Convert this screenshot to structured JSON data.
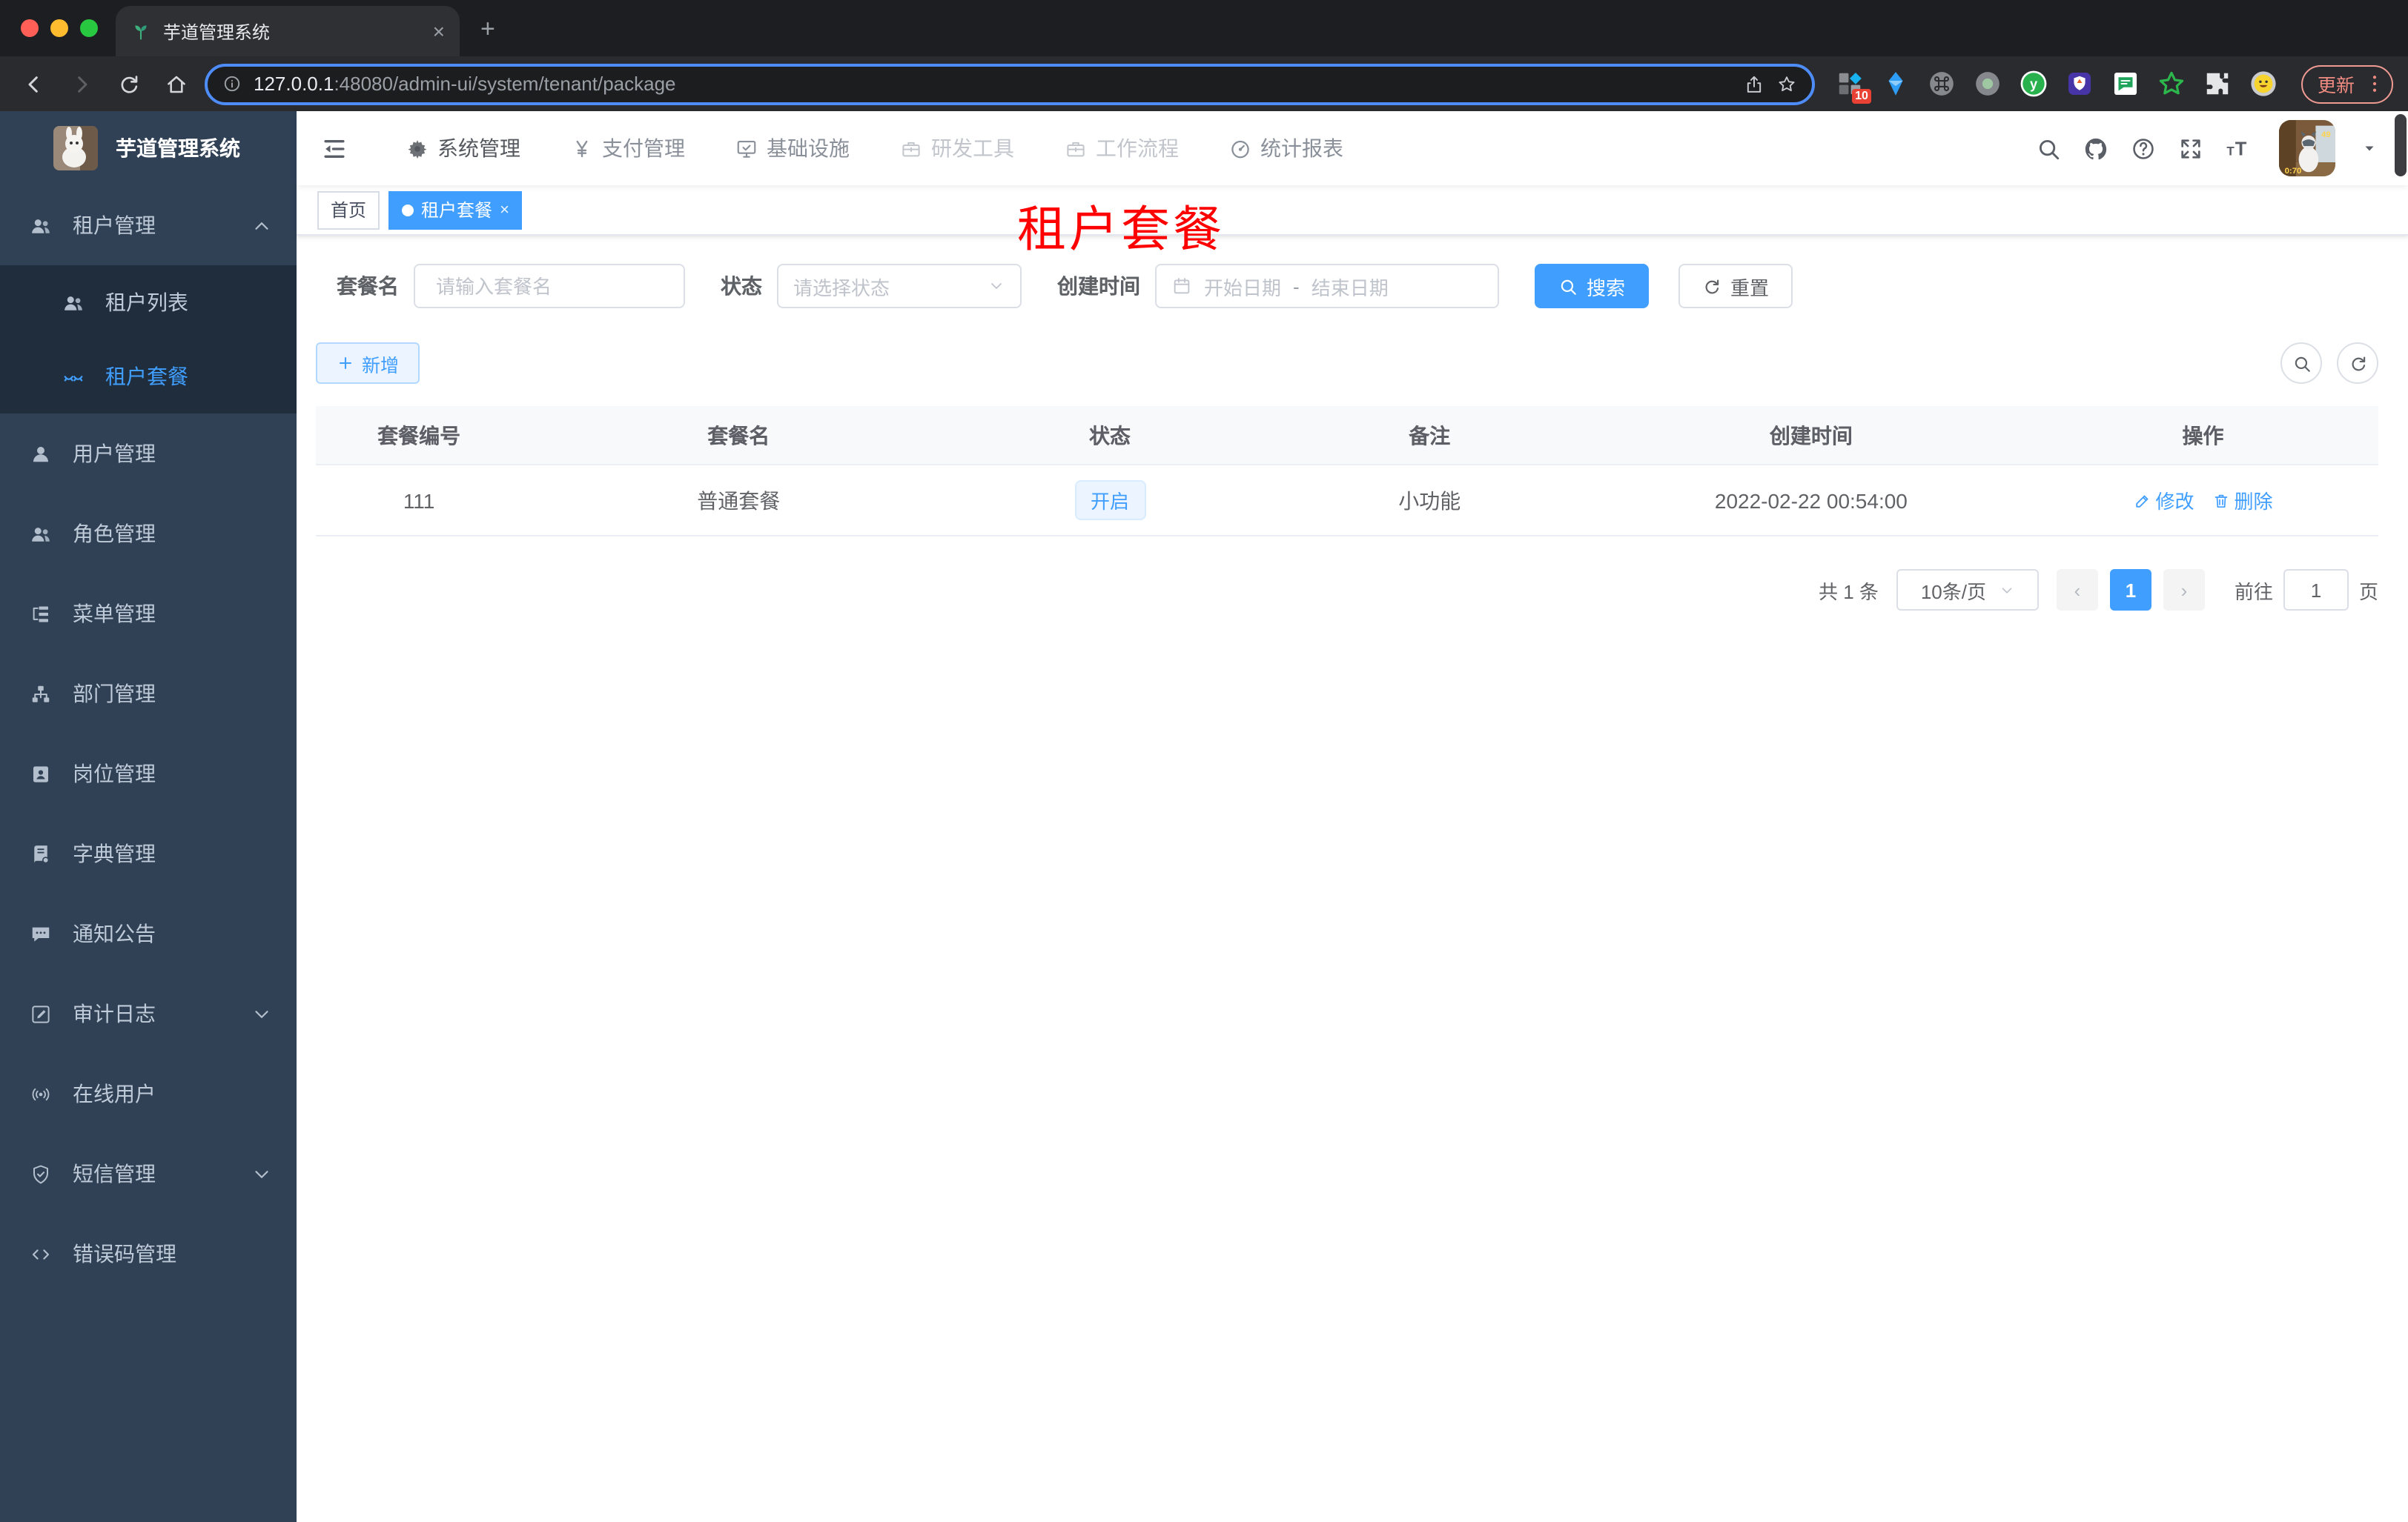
{
  "colors": {
    "accent": "#409eff",
    "overlay_red": "#ff0000",
    "sidebar_bg": "#304156",
    "submenu_bg": "#1f2d3d",
    "tag_active_bg": "#409eff"
  },
  "browser": {
    "tab": {
      "title": "芋道管理系统",
      "favicon": "plant-icon",
      "close_glyph": "×",
      "new_tab_glyph": "+"
    },
    "url_host": "127.0.0.1",
    "url_path": ":48080/admin-ui/system/tenant/package",
    "update_label": "更新",
    "extensions": [
      {
        "icon": "extension-grid-icon",
        "badge": "10"
      },
      {
        "icon": "extension-gem-icon"
      },
      {
        "icon": "extension-command-icon"
      },
      {
        "icon": "extension-circle-icon"
      },
      {
        "icon": "extension-y-icon"
      },
      {
        "icon": "extension-shield-icon"
      },
      {
        "icon": "extension-chat-icon"
      },
      {
        "icon": "extension-star-icon"
      },
      {
        "icon": "extension-puzzle-icon"
      },
      {
        "icon": "extension-emoji-icon"
      }
    ]
  },
  "sidebar": {
    "logo_title": "芋道管理系统",
    "items": [
      {
        "label": "租户管理",
        "icon": "user-group-icon",
        "caret": "up",
        "type": "top"
      },
      {
        "label": "租户列表",
        "icon": "users-icon",
        "type": "sub"
      },
      {
        "label": "租户套餐",
        "icon": "closed-eyes-icon",
        "type": "sub",
        "active": true
      },
      {
        "label": "用户管理",
        "icon": "user-icon",
        "type": "top"
      },
      {
        "label": "角色管理",
        "icon": "user-group-icon",
        "type": "top"
      },
      {
        "label": "菜单管理",
        "icon": "tree-table-icon",
        "type": "top"
      },
      {
        "label": "部门管理",
        "icon": "org-tree-icon",
        "type": "top"
      },
      {
        "label": "岗位管理",
        "icon": "id-badge-icon",
        "type": "top"
      },
      {
        "label": "字典管理",
        "icon": "dict-book-icon",
        "type": "top"
      },
      {
        "label": "通知公告",
        "icon": "message-icon",
        "type": "top"
      },
      {
        "label": "审计日志",
        "icon": "log-edit-icon",
        "caret": "down",
        "type": "top"
      },
      {
        "label": "在线用户",
        "icon": "broadcast-icon",
        "type": "top"
      },
      {
        "label": "短信管理",
        "icon": "shield-check-icon",
        "caret": "down",
        "type": "top"
      },
      {
        "label": "错误码管理",
        "icon": "code-icon",
        "type": "top"
      }
    ]
  },
  "header": {
    "nav_items": [
      {
        "label": "系统管理",
        "icon": "gear-icon",
        "state": "active"
      },
      {
        "label": "支付管理",
        "icon": "yen-icon",
        "state": "normal"
      },
      {
        "label": "基础设施",
        "icon": "monitor-icon",
        "state": "normal"
      },
      {
        "label": "研发工具",
        "icon": "toolbox-icon",
        "state": "muted"
      },
      {
        "label": "工作流程",
        "icon": "briefcase-icon",
        "state": "muted"
      },
      {
        "label": "统计报表",
        "icon": "dashboard-icon",
        "state": "normal"
      }
    ],
    "right_icons": [
      "search-icon",
      "github-icon",
      "question-icon",
      "fullscreen-icon",
      "font-size-icon"
    ]
  },
  "tags": {
    "home": "首页",
    "active": "租户套餐",
    "close_glyph": "×"
  },
  "overlay_title": {
    "text": "租户套餐"
  },
  "filters": {
    "name_label": "套餐名",
    "name_placeholder": "请输入套餐名",
    "status_label": "状态",
    "status_placeholder": "请选择状态",
    "date_label": "创建时间",
    "date_start": "开始日期",
    "date_separator": "-",
    "date_end": "结束日期",
    "search_label": "搜索",
    "reset_label": "重置"
  },
  "toolbar": {
    "add_label": "新增"
  },
  "table": {
    "columns": [
      "套餐编号",
      "套餐名",
      "状态",
      "备注",
      "创建时间",
      "操作"
    ],
    "row": {
      "id": "111",
      "name": "普通套餐",
      "status": "开启",
      "remark": "小功能",
      "created": "2022-02-22 00:54:00",
      "actions": [
        {
          "label": "修改",
          "icon": "edit-icon"
        },
        {
          "label": "删除",
          "icon": "delete-icon"
        }
      ]
    }
  },
  "pagination": {
    "total_text": "共 1 条",
    "page_size": "10条/页",
    "current_page": "1",
    "prev_glyph": "‹",
    "next_glyph": "›",
    "goto_label": "前往",
    "goto_value": "1",
    "page_unit": "页"
  }
}
